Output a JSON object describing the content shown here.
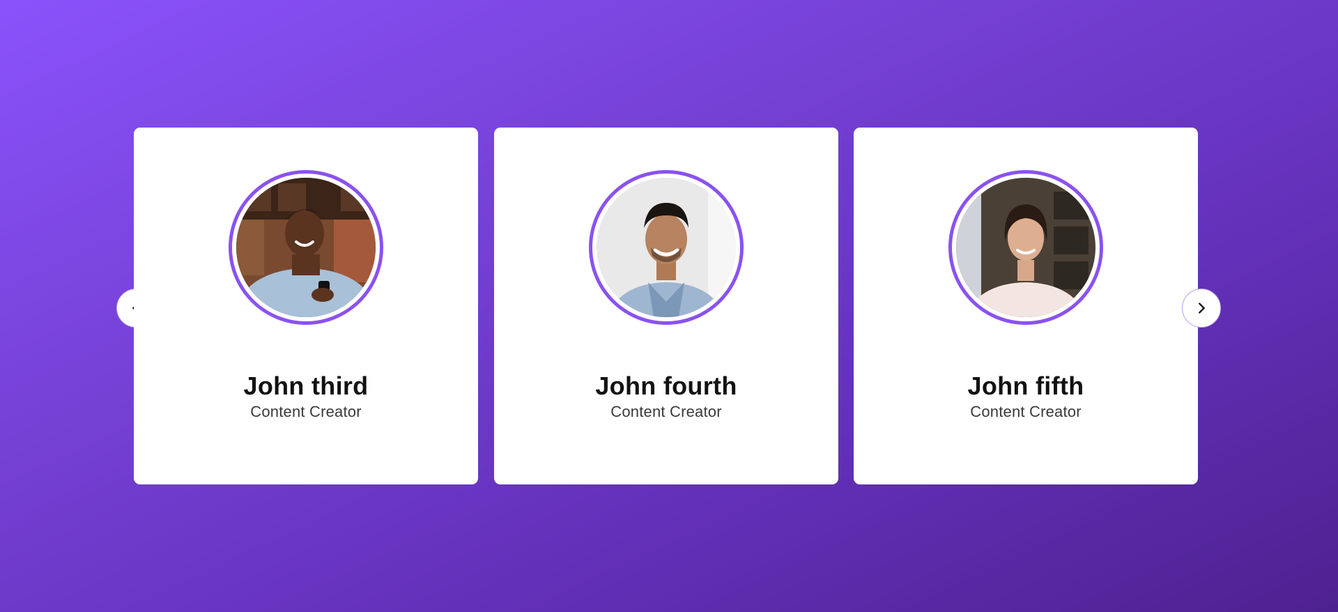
{
  "carousel": {
    "prev_icon": "chevron-left-icon",
    "next_icon": "chevron-right-icon",
    "cards": [
      {
        "name": "John third",
        "role": "Content Creator",
        "avatar": "portrait-man-with-phone"
      },
      {
        "name": "John fourth",
        "role": "Content Creator",
        "avatar": "portrait-smiling-man"
      },
      {
        "name": "John fifth",
        "role": "Content Creator",
        "avatar": "portrait-smiling-woman"
      }
    ]
  },
  "colors": {
    "background_start": "#8a52fb",
    "background_end": "#4e2190",
    "avatar_ring": "#8a52f0",
    "card": "#ffffff"
  }
}
